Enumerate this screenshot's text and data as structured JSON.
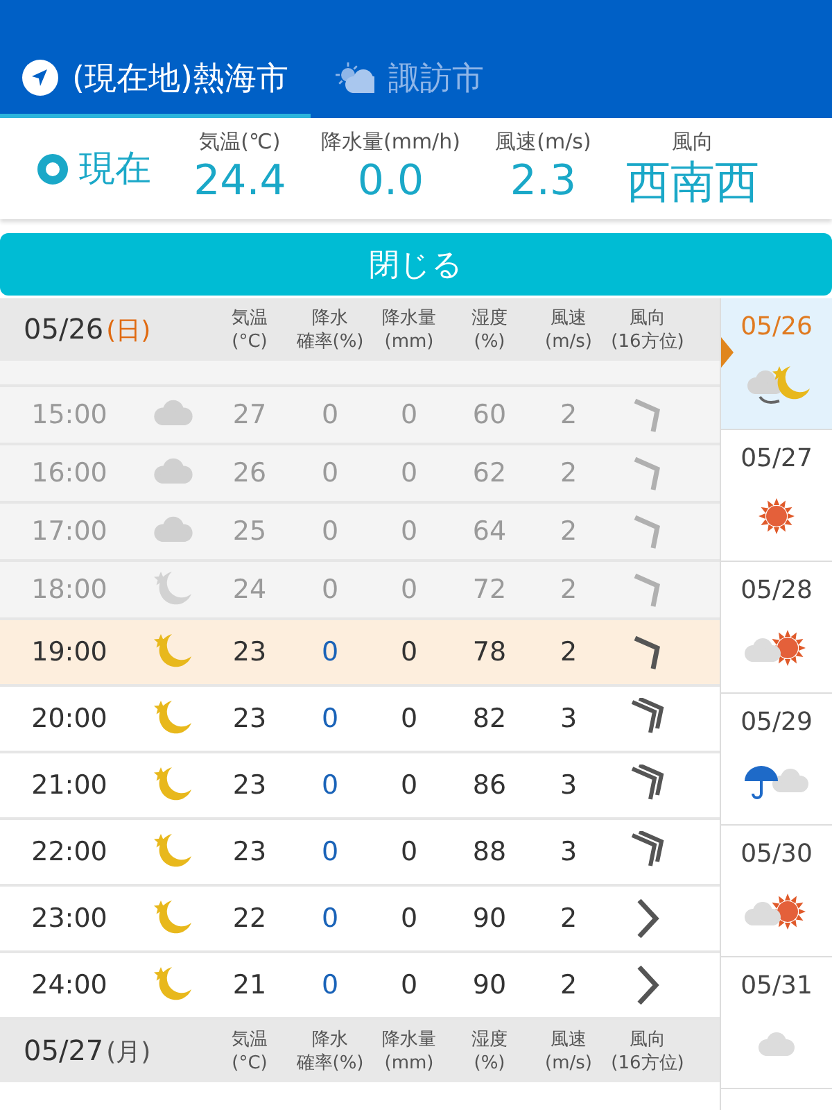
{
  "tabs": [
    {
      "label": "(現在地)熱海市",
      "kind": "location",
      "selected": true
    },
    {
      "label": "諏訪市",
      "kind": "weather",
      "selected": false
    }
  ],
  "current": {
    "label": "現在",
    "stats": [
      {
        "label": "気温(℃)",
        "value": "24.4"
      },
      {
        "label": "降水量(mm/h)",
        "value": "0.0"
      },
      {
        "label": "風速(m/s)",
        "value": "2.3"
      },
      {
        "label": "風向",
        "value": "西南西"
      }
    ]
  },
  "close_button": "閉じる",
  "days": [
    {
      "date": "05/26",
      "weekday": "(日)",
      "holiday": true,
      "columns": [
        [
          "気温",
          "(°C)"
        ],
        [
          "降水",
          "確率(%)"
        ],
        [
          "降水量",
          "(mm)"
        ],
        [
          "湿度",
          "(%)"
        ],
        [
          "風速",
          "(m/s)"
        ],
        [
          "風向",
          "(16方位)"
        ]
      ],
      "rows": [
        {
          "time": "15:00",
          "weather": {
            "kind": "cloud"
          },
          "temp": "27",
          "pop": "0",
          "precip": "0",
          "humidity": "60",
          "wind": "2",
          "arrow": {
            "kind": "tilted"
          },
          "past": true,
          "selected": false
        },
        {
          "time": "16:00",
          "weather": {
            "kind": "cloud"
          },
          "temp": "26",
          "pop": "0",
          "precip": "0",
          "humidity": "62",
          "wind": "2",
          "arrow": {
            "kind": "tilted"
          },
          "past": true,
          "selected": false
        },
        {
          "time": "17:00",
          "weather": {
            "kind": "cloud"
          },
          "temp": "25",
          "pop": "0",
          "precip": "0",
          "humidity": "64",
          "wind": "2",
          "arrow": {
            "kind": "tilted"
          },
          "past": true,
          "selected": false
        },
        {
          "time": "18:00",
          "weather": {
            "kind": "moon"
          },
          "temp": "24",
          "pop": "0",
          "precip": "0",
          "humidity": "72",
          "wind": "2",
          "arrow": {
            "kind": "tilted"
          },
          "past": true,
          "selected": false
        },
        {
          "time": "19:00",
          "weather": {
            "kind": "moon"
          },
          "temp": "23",
          "pop": "0",
          "precip": "0",
          "humidity": "78",
          "wind": "2",
          "arrow": {
            "kind": "tilted"
          },
          "past": false,
          "selected": true
        },
        {
          "time": "20:00",
          "weather": {
            "kind": "moon"
          },
          "temp": "23",
          "pop": "0",
          "precip": "0",
          "humidity": "82",
          "wind": "3",
          "arrow": {
            "kind": "double"
          },
          "past": false,
          "selected": false
        },
        {
          "time": "21:00",
          "weather": {
            "kind": "moon"
          },
          "temp": "23",
          "pop": "0",
          "precip": "0",
          "humidity": "86",
          "wind": "3",
          "arrow": {
            "kind": "double"
          },
          "past": false,
          "selected": false
        },
        {
          "time": "22:00",
          "weather": {
            "kind": "moon"
          },
          "temp": "23",
          "pop": "0",
          "precip": "0",
          "humidity": "88",
          "wind": "3",
          "arrow": {
            "kind": "double"
          },
          "past": false,
          "selected": false
        },
        {
          "time": "23:00",
          "weather": {
            "kind": "moon"
          },
          "temp": "22",
          "pop": "0",
          "precip": "0",
          "humidity": "90",
          "wind": "2",
          "arrow": {
            "kind": "flat"
          },
          "past": false,
          "selected": false
        },
        {
          "time": "24:00",
          "weather": {
            "kind": "moon"
          },
          "temp": "21",
          "pop": "0",
          "precip": "0",
          "humidity": "90",
          "wind": "2",
          "arrow": {
            "kind": "flat"
          },
          "past": false,
          "selected": false
        }
      ]
    },
    {
      "date": "05/27",
      "weekday": "(月)",
      "holiday": false,
      "columns": [
        [
          "気温",
          "(°C)"
        ],
        [
          "降水",
          "確率(%)"
        ],
        [
          "降水量",
          "(mm)"
        ],
        [
          "湿度",
          "(%)"
        ],
        [
          "風速",
          "(m/s)"
        ],
        [
          "風向",
          "(16方位)"
        ]
      ]
    }
  ],
  "sidebar": [
    {
      "date": "05/26",
      "weather": {
        "kind": "cloud-moon"
      },
      "selected": true
    },
    {
      "date": "05/27",
      "weather": {
        "kind": "sun"
      },
      "selected": false
    },
    {
      "date": "05/28",
      "weather": {
        "kind": "cloud-sun"
      },
      "selected": false
    },
    {
      "date": "05/29",
      "weather": {
        "kind": "umbrella-cloud"
      },
      "selected": false
    },
    {
      "date": "05/30",
      "weather": {
        "kind": "cloud-sun"
      },
      "selected": false
    },
    {
      "date": "05/31",
      "weather": {
        "kind": "cloud"
      },
      "selected": false
    }
  ]
}
